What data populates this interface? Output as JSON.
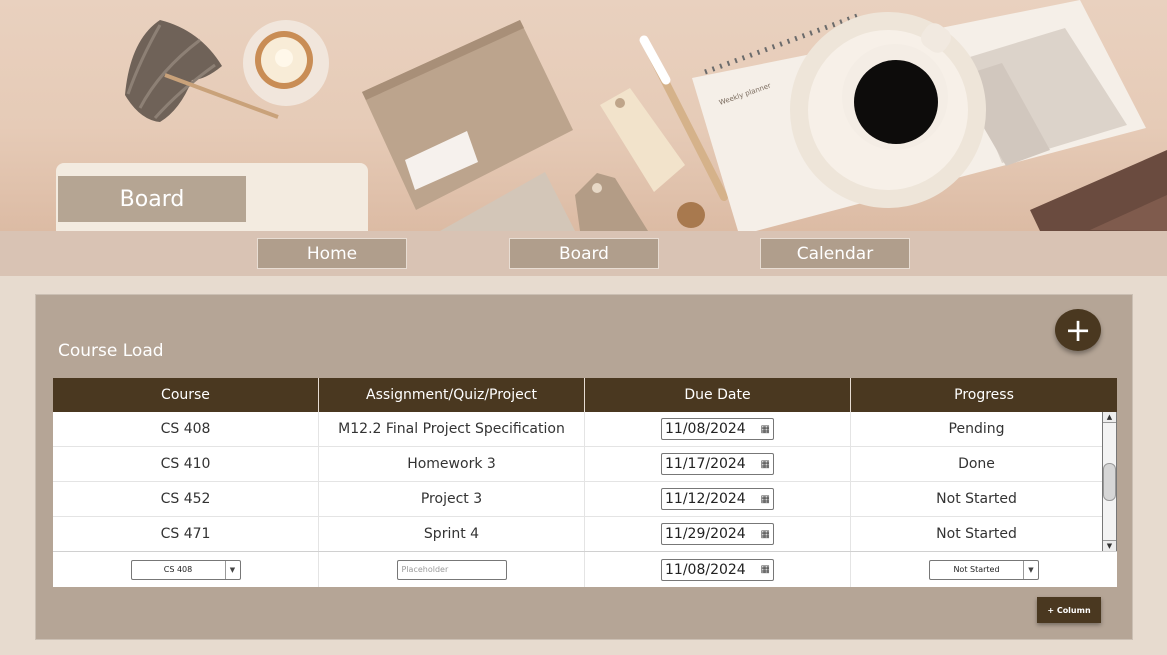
{
  "hero": {
    "title": "Board",
    "planner_text": "Weekly planner"
  },
  "nav": {
    "items": [
      "Home",
      "Board",
      "Calendar"
    ]
  },
  "section": {
    "title": "Course Load",
    "add_button": "+"
  },
  "table": {
    "columns": [
      "Course",
      "Assignment/Quiz/Project",
      "Due Date",
      "Progress"
    ],
    "rows": [
      {
        "course": "CS 408",
        "assignment": "M12.2 Final Project Specification",
        "due": "11/08/2024",
        "progress": "Pending"
      },
      {
        "course": "CS 410",
        "assignment": "Homework 3",
        "due": "11/17/2024",
        "progress": "Done"
      },
      {
        "course": "CS 452",
        "assignment": "Project 3",
        "due": "11/12/2024",
        "progress": "Not Started"
      },
      {
        "course": "CS 471",
        "assignment": "Sprint 4",
        "due": "11/29/2024",
        "progress": "Not Started"
      }
    ],
    "new_row": {
      "course_select": "CS 408",
      "assignment_placeholder": "Placeholder",
      "due": "11/08/2024",
      "progress_select": "Not Started"
    }
  },
  "add_column_label": "+ Column",
  "colors": {
    "header_brown": "#4a3820",
    "card_bg": "#b5a596",
    "nav_btn": "#b09e8c",
    "page_bg": "#e7dbcf"
  },
  "icons": {
    "calendar": "calendar-icon",
    "dropdown": "chevron-down-icon",
    "scroll_up": "triangle-up-icon",
    "scroll_down": "triangle-down-icon"
  }
}
